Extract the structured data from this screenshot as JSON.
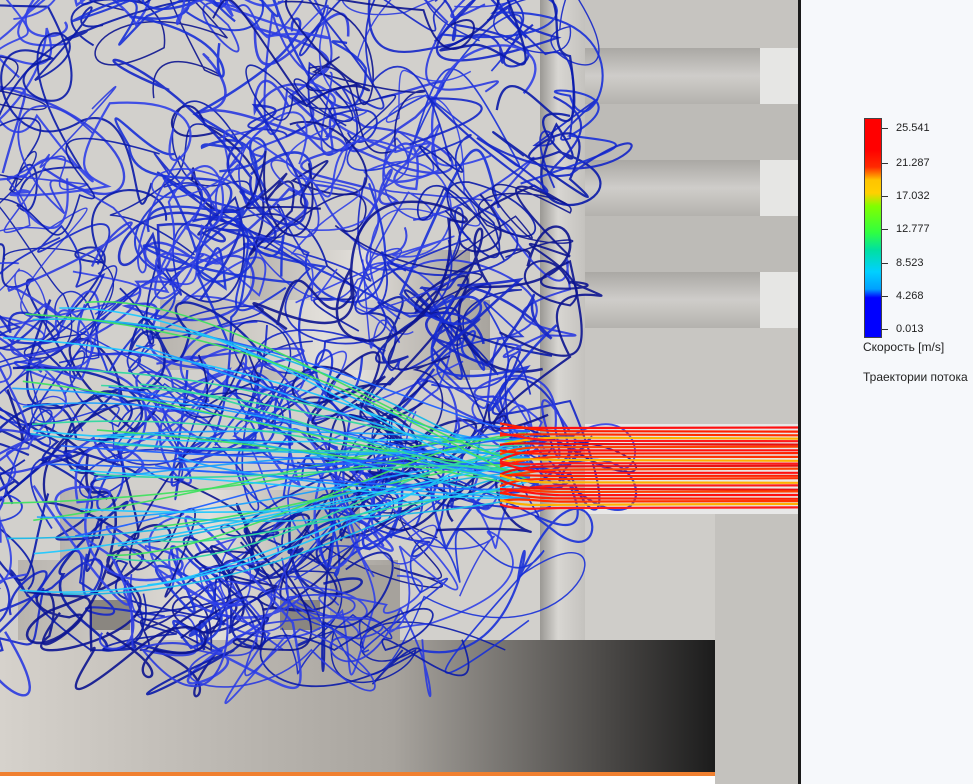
{
  "legend": {
    "ticks": [
      "25.541",
      "21.287",
      "17.032",
      "12.777",
      "8.523",
      "4.268",
      "0.013"
    ],
    "unit_label": "Скорость [m/s]",
    "title": "Траектории потока"
  },
  "colors": {
    "background": "#ffffff",
    "model_gray": "#c8c6c2",
    "frame_dark": "#1a1a1a",
    "trajectory_blue": "#1a2acc",
    "trajectory_red": "#ff1010",
    "accent_orange": "#f08030"
  }
}
